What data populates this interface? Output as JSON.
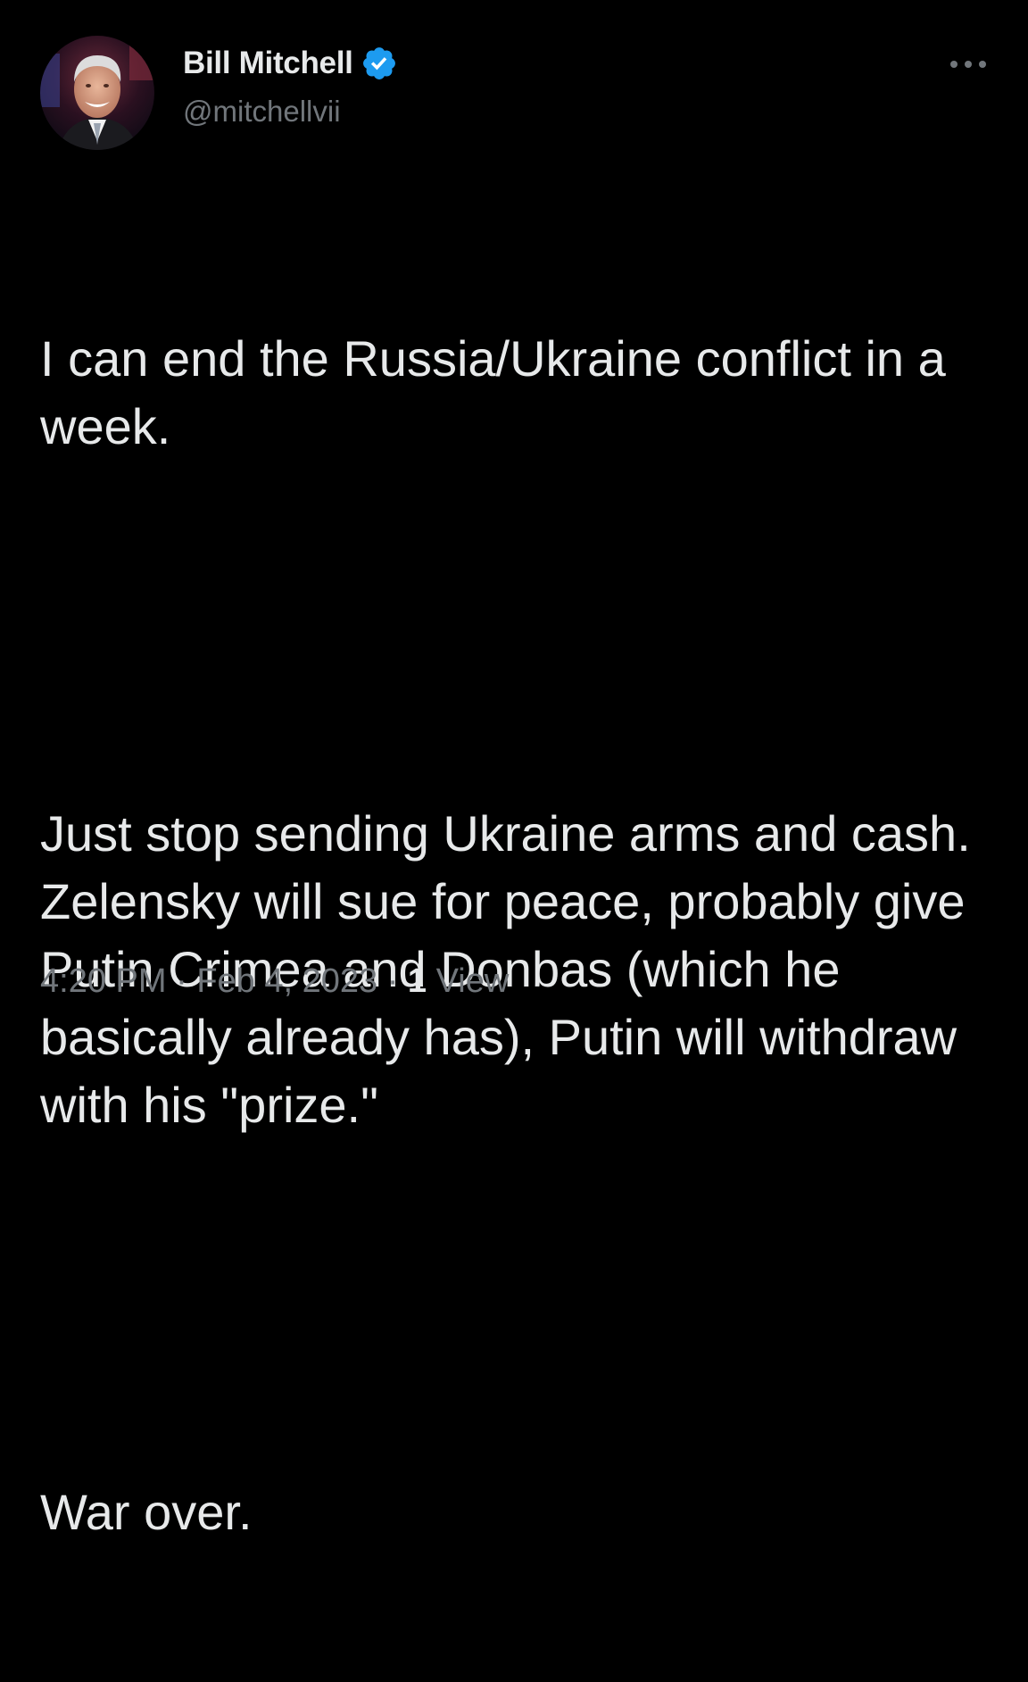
{
  "author": {
    "display_name": "Bill Mitchell",
    "handle": "@mitchellvii",
    "verified": true,
    "verified_color": "#1d9bf0"
  },
  "menu": {
    "icon": "more-horizontal-icon"
  },
  "tweet": {
    "paragraphs": [
      "I can end the Russia/Ukraine conflict in a week.",
      "Just stop sending Ukraine arms and cash.  Zelensky will sue for peace, probably give Putin Crimea and Donbas (which he basically already has), Putin will withdraw with his \"prize.\"",
      "War over."
    ]
  },
  "meta": {
    "time": "4:20 PM",
    "separator": "·",
    "date": "Feb 4, 2023",
    "views_count": "1",
    "views_label": "View"
  },
  "colors": {
    "background": "#000000",
    "text": "#e7e9ea",
    "secondary": "#71767b"
  }
}
